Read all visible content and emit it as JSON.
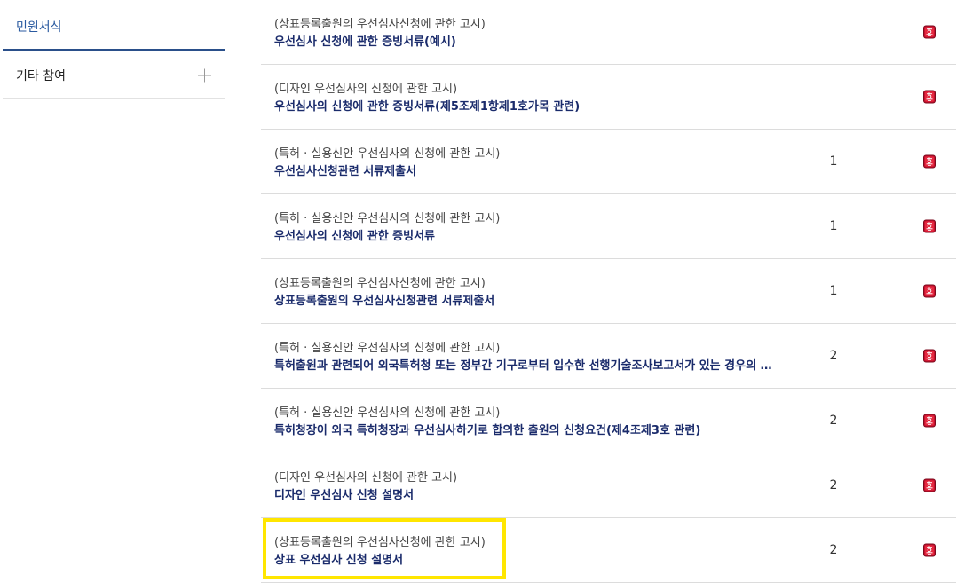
{
  "sidebar": {
    "items": [
      {
        "label": "민원서식",
        "active": true
      },
      {
        "label": "기타 참여",
        "active": false
      }
    ]
  },
  "table": {
    "rows": [
      {
        "category": "(상표등록출원의 우선심사신청에 관한 고시)",
        "title": "우선심사 신청에 관한 증빙서류(예시)",
        "count": ""
      },
      {
        "category": "(디자인 우선심사의 신청에 관한 고시)",
        "title": "우선심사의 신청에 관한 증빙서류(제5조제1항제1호가목 관련)",
        "count": ""
      },
      {
        "category": "(특허 · 실용신안 우선심사의 신청에 관한 고시)",
        "title": "우선심사신청관련 서류제출서",
        "count": "1"
      },
      {
        "category": "(특허 · 실용신안 우선심사의 신청에 관한 고시)",
        "title": "우선심사의 신청에 관한 증빙서류",
        "count": "1"
      },
      {
        "category": "(상표등록출원의 우선심사신청에 관한 고시)",
        "title": "상표등록출원의 우선심사신청관련 서류제출서",
        "count": "1"
      },
      {
        "category": "(특허 · 실용신안 우선심사의 신청에 관한 고시)",
        "title": "특허출원과 관련되어 외국특허청 또는 정부간 기구로부터 입수한 선행기술조사보고서가 있는 경우의 …",
        "count": "2"
      },
      {
        "category": "(특허 · 실용신안 우선심사의 신청에 관한 고시)",
        "title": "특허청장이 외국 특허청장과 우선심사하기로 합의한 출원의 신청요건(제4조제3호 관련)",
        "count": "2"
      },
      {
        "category": "(디자인 우선심사의 신청에 관한 고시)",
        "title": "디자인 우선심사 신청 설명서",
        "count": "2"
      },
      {
        "category": "(상표등록출원의 우선심사신청에 관한 고시)",
        "title": "상표 우선심사 신청 설명서",
        "count": "2"
      }
    ]
  },
  "colors": {
    "accent": "#2a4f8a",
    "title": "#1a2b6b",
    "highlight": "#ffe600",
    "file_icon": "#c8102e"
  }
}
